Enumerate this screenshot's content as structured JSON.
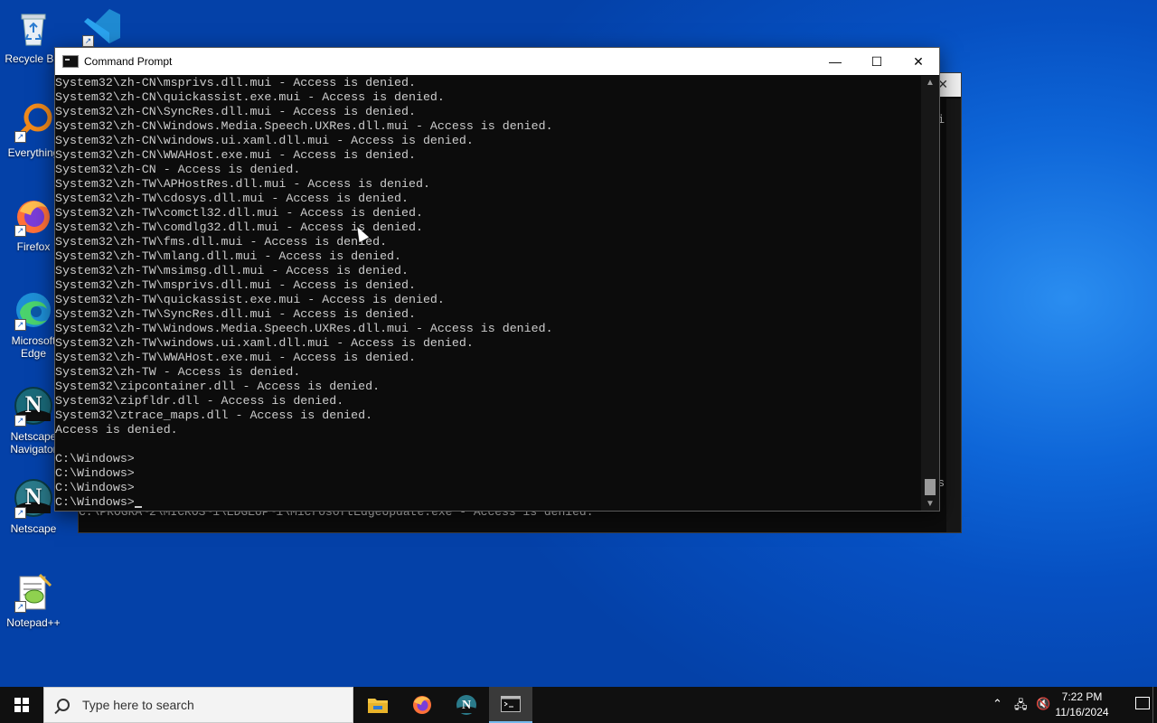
{
  "desktop": {
    "icons": [
      {
        "label": "Recycle Bin",
        "name": "recycle-bin"
      },
      {
        "label": "Everything",
        "name": "everything"
      },
      {
        "label": "Firefox",
        "name": "firefox"
      },
      {
        "label": "Microsoft Edge",
        "name": "edge"
      },
      {
        "label": "Netscape Navigator",
        "name": "netscape-navigator"
      },
      {
        "label": "Netscape",
        "name": "netscape"
      },
      {
        "label": "Notepad++",
        "name": "notepad-plus-plus"
      }
    ]
  },
  "back_window": {
    "visible_line": "C:\\PROGRA~2\\MICROS~1\\EDGEUP~1\\MicrosoftEdgeUpdate.exe - Access is denied.",
    "side_char_top": "i",
    "side_char_bottom": "s"
  },
  "window": {
    "title": "Command Prompt",
    "minimize": "—",
    "maximize": "☐",
    "close": "✕"
  },
  "console": {
    "lines": [
      "System32\\zh-CN\\msprivs.dll.mui - Access is denied.",
      "System32\\zh-CN\\quickassist.exe.mui - Access is denied.",
      "System32\\zh-CN\\SyncRes.dll.mui - Access is denied.",
      "System32\\zh-CN\\Windows.Media.Speech.UXRes.dll.mui - Access is denied.",
      "System32\\zh-CN\\windows.ui.xaml.dll.mui - Access is denied.",
      "System32\\zh-CN\\WWAHost.exe.mui - Access is denied.",
      "System32\\zh-CN - Access is denied.",
      "System32\\zh-TW\\APHostRes.dll.mui - Access is denied.",
      "System32\\zh-TW\\cdosys.dll.mui - Access is denied.",
      "System32\\zh-TW\\comctl32.dll.mui - Access is denied.",
      "System32\\zh-TW\\comdlg32.dll.mui - Access is denied.",
      "System32\\zh-TW\\fms.dll.mui - Access is denied.",
      "System32\\zh-TW\\mlang.dll.mui - Access is denied.",
      "System32\\zh-TW\\msimsg.dll.mui - Access is denied.",
      "System32\\zh-TW\\msprivs.dll.mui - Access is denied.",
      "System32\\zh-TW\\quickassist.exe.mui - Access is denied.",
      "System32\\zh-TW\\SyncRes.dll.mui - Access is denied.",
      "System32\\zh-TW\\Windows.Media.Speech.UXRes.dll.mui - Access is denied.",
      "System32\\zh-TW\\windows.ui.xaml.dll.mui - Access is denied.",
      "System32\\zh-TW\\WWAHost.exe.mui - Access is denied.",
      "System32\\zh-TW - Access is denied.",
      "System32\\zipcontainer.dll - Access is denied.",
      "System32\\zipfldr.dll - Access is denied.",
      "System32\\ztrace_maps.dll - Access is denied.",
      "Access is denied.",
      "",
      "C:\\Windows>",
      "C:\\Windows>",
      "C:\\Windows>",
      "C:\\Windows>"
    ]
  },
  "taskbar": {
    "search_placeholder": "Type here to search",
    "apps": [
      "file-explorer",
      "firefox",
      "netscape",
      "command-prompt"
    ],
    "active_app": "command-prompt",
    "clock_time": "7:22 PM",
    "clock_date": "11/16/2024"
  },
  "colors": {
    "console_bg": "#0c0c0c",
    "console_text": "#cccccc",
    "taskbar_bg": "#101010",
    "desktop_blue": "#0650c2"
  }
}
